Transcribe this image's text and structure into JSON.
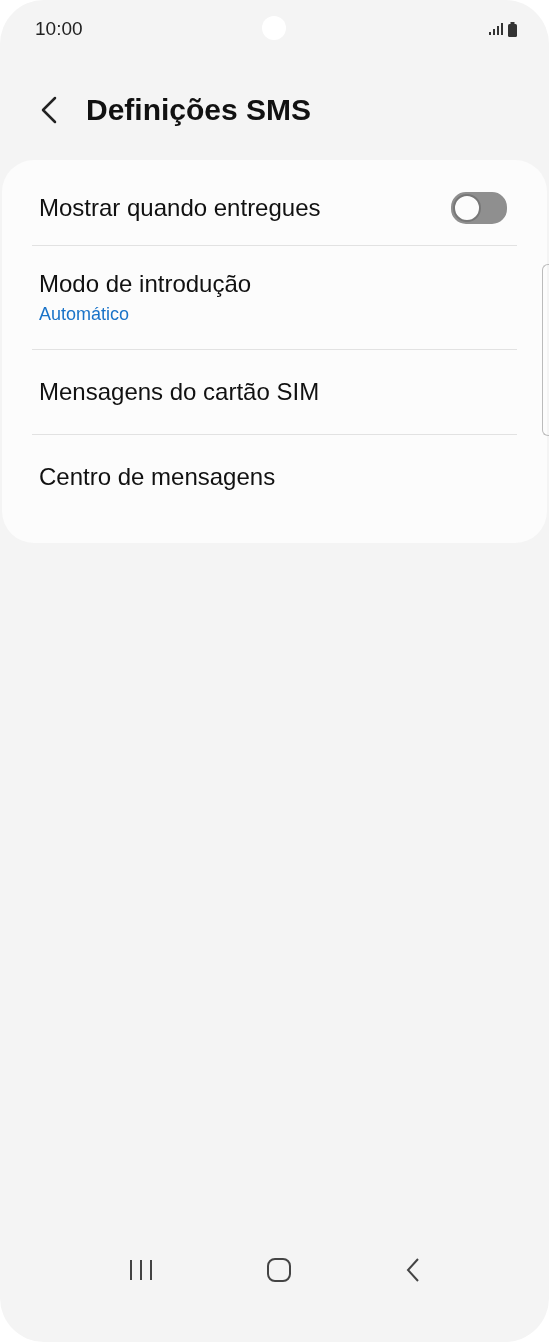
{
  "status_bar": {
    "time": "10:00"
  },
  "header": {
    "title": "Definições SMS"
  },
  "settings": [
    {
      "kind": "toggle",
      "label": "Mostrar quando entregues",
      "on": false
    },
    {
      "kind": "value",
      "label": "Modo de introdução",
      "value": "Automático"
    },
    {
      "kind": "plain",
      "label": "Mensagens do cartão SIM"
    },
    {
      "kind": "plain",
      "label": "Centro de mensagens"
    }
  ]
}
